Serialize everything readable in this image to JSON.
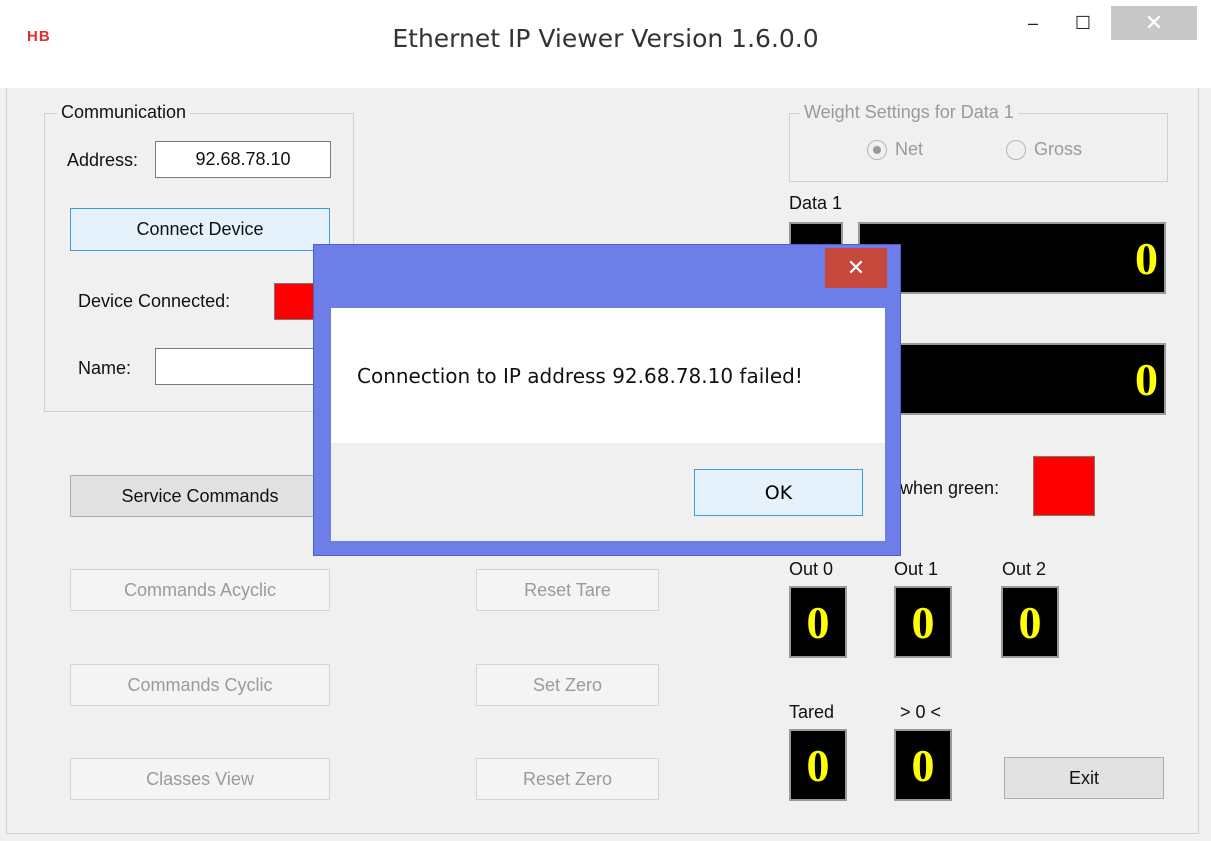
{
  "window": {
    "logo": "HB",
    "title": "Ethernet IP Viewer Version 1.6.0.0",
    "minimize_glyph": "–",
    "maximize_glyph": "☐",
    "close_glyph": "✕"
  },
  "communication": {
    "legend": "Communication",
    "address_label": "Address:",
    "address_value": "92.68.78.10",
    "connect_button": "Connect Device",
    "device_connected_label": "Device Connected:",
    "name_label": "Name:",
    "name_value": ""
  },
  "buttons": {
    "service_commands": "Service Commands",
    "commands_acyclic": "Commands Acyclic",
    "commands_cyclic": "Commands Cyclic",
    "classes_view": "Classes View",
    "reset_tare": "Reset Tare",
    "set_zero": "Set Zero",
    "reset_zero": "Reset Zero",
    "exit": "Exit"
  },
  "weight_settings": {
    "legend": "Weight Settings for Data 1",
    "net_label": "Net",
    "gross_label": "Gross",
    "selected": "Net"
  },
  "data": {
    "data1_label": "Data 1",
    "data1_value": "0",
    "data2_value": "0",
    "green_label": "when green:"
  },
  "outputs": {
    "out0_label": "Out 0",
    "out1_label": "Out 1",
    "out2_label": "Out 2",
    "out0_value": "0",
    "out1_value": "0",
    "out2_value": "0",
    "tared_label": "Tared",
    "zero_label": "> 0 <",
    "tared_value": "0",
    "zero_value": "0"
  },
  "dialog": {
    "message": "Connection to IP address 92.68.78.10 failed!",
    "ok_label": "OK",
    "close_glyph": "✕"
  },
  "colors": {
    "indicator_off": "#ff0000",
    "display_bg": "#000000",
    "display_fg": "#ffff00",
    "dialog_frame": "#6d7ee8",
    "dialog_close": "#c7493e"
  }
}
